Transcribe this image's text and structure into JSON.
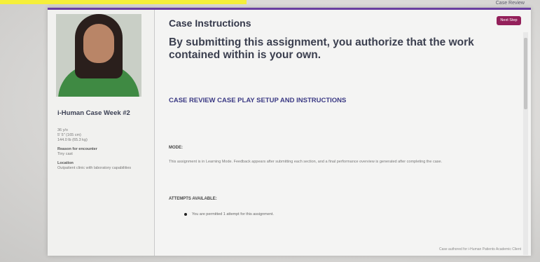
{
  "header": {
    "top_right_label": "Case Review"
  },
  "sidebar": {
    "case_name": "i-Human Case Week #2",
    "patient_age": "36 y/o",
    "patient_height": "5' 5\" (165 cm)",
    "patient_weight": "144.0 lb (65.3 kg)",
    "reason_label": "Reason for encounter",
    "reason_value": "Tiny cast",
    "location_label": "Location",
    "location_value": "Outpatient clinic with laboratory capabilities"
  },
  "main": {
    "title": "Case Instructions",
    "notice": "By submitting this assignment, you authorize that the work contained within is your own.",
    "save_label": "Next Step",
    "section_heading": "CASE REVIEW CASE PLAY SETUP AND INSTRUCTIONS",
    "mode_label": "MODE:",
    "mode_text": "This assignment is in Learning Mode. Feedback appears after submitting each section, and a final performance overview is generated after completing the case.",
    "attempts_label": "ATTEMPTS AVAILABLE:",
    "attempts_text": "You are permitted 1 attempt for this assignment."
  },
  "footer": {
    "text": "Case authored for i-Human Patients Academic Client"
  },
  "colors": {
    "accent_purple": "#6a3fa0",
    "button_magenta": "#93205a",
    "heading_blue": "#3b3a84",
    "highlight_yellow": "#f5ef3a"
  }
}
